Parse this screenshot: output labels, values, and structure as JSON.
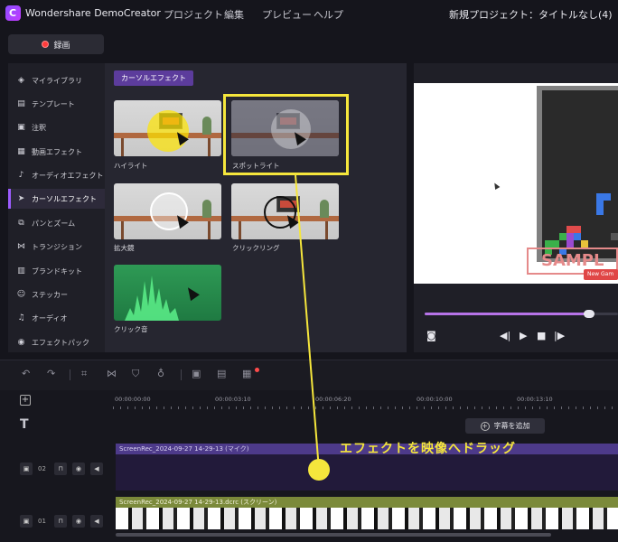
{
  "app": {
    "title": "Wondershare DemoCreator",
    "project_title": "新規プロジェクト：タイトルなし(4)"
  },
  "menu": [
    "プロジェクト",
    "編集",
    "プレビュー",
    "ヘルプ"
  ],
  "record_button": {
    "label": "録画"
  },
  "sidebar": {
    "items": [
      {
        "label": "マイライブラリ",
        "icon": "layers-icon"
      },
      {
        "label": "テンプレート",
        "icon": "template-icon"
      },
      {
        "label": "注釈",
        "icon": "annotation-icon"
      },
      {
        "label": "動画エフェクト",
        "icon": "video-effect-icon"
      },
      {
        "label": "オーディオエフェクト",
        "icon": "audio-effect-icon"
      },
      {
        "label": "カーソルエフェクト",
        "icon": "cursor-icon",
        "active": true
      },
      {
        "label": "パンとズーム",
        "icon": "pan-zoom-icon"
      },
      {
        "label": "トランジション",
        "icon": "transition-icon"
      },
      {
        "label": "ブランドキット",
        "icon": "brand-kit-icon"
      },
      {
        "label": "ステッカー",
        "icon": "sticker-icon"
      },
      {
        "label": "オーディオ",
        "icon": "music-icon"
      },
      {
        "label": "エフェクトパック",
        "icon": "effect-pack-icon"
      }
    ]
  },
  "gallery": {
    "section_tag": "カーソルエフェクト",
    "cards": [
      {
        "label": "ハイライト"
      },
      {
        "label": "スポットライト",
        "selected": true
      },
      {
        "label": "拡大鏡"
      },
      {
        "label": "クリックリング"
      },
      {
        "label": "クリック音"
      }
    ]
  },
  "preview": {
    "watermark": "SAMPL",
    "button": "New Gam",
    "progress": 0.85
  },
  "timeline": {
    "ticks": [
      "00:00:00:00",
      "00:00:03:10",
      "00:00:06:20",
      "00:00:10:00",
      "00:00:13:10"
    ],
    "add_subtitle_label": "字幕を追加",
    "tracks": [
      {
        "number": "02",
        "clip": "ScreenRec_2024-09-27 14-29-13 (マイク)"
      },
      {
        "number": "01",
        "clip": "ScreenRec_2024-09-27 14-29-13.dcrc (スクリーン)"
      }
    ]
  },
  "annotation": {
    "text": "エフェクトを映像へドラッグ",
    "color": "#f5e63c"
  },
  "colors": {
    "accent": "#9c5cff",
    "highlight": "#f5e63c",
    "record": "#ff3b3b"
  }
}
